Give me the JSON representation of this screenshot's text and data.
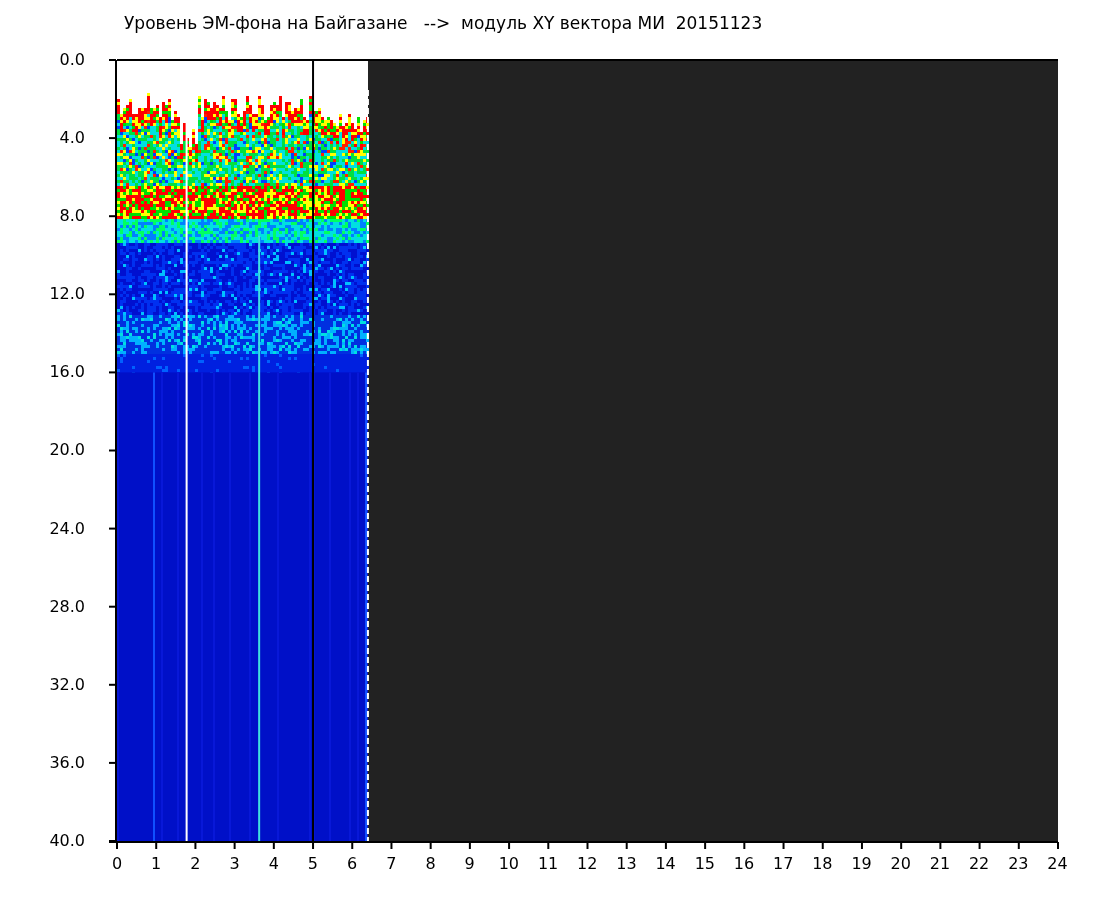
{
  "title": "Уровень ЭМ-фона на Байгазане   -->  модуль XY вектора МИ  20151123",
  "y_axis": {
    "ticks": [
      "0.0",
      "4.0",
      "8.0",
      "12.0",
      "16.0",
      "20.0",
      "24.0",
      "28.0",
      "32.0",
      "36.0",
      "40.0"
    ]
  },
  "x_axis": {
    "ticks": [
      "0",
      "1",
      "2",
      "3",
      "4",
      "5",
      "6",
      "7",
      "8",
      "9",
      "10",
      "11",
      "12",
      "13",
      "14",
      "15",
      "16",
      "17",
      "18",
      "19",
      "20",
      "21",
      "22",
      "23",
      "24"
    ]
  }
}
